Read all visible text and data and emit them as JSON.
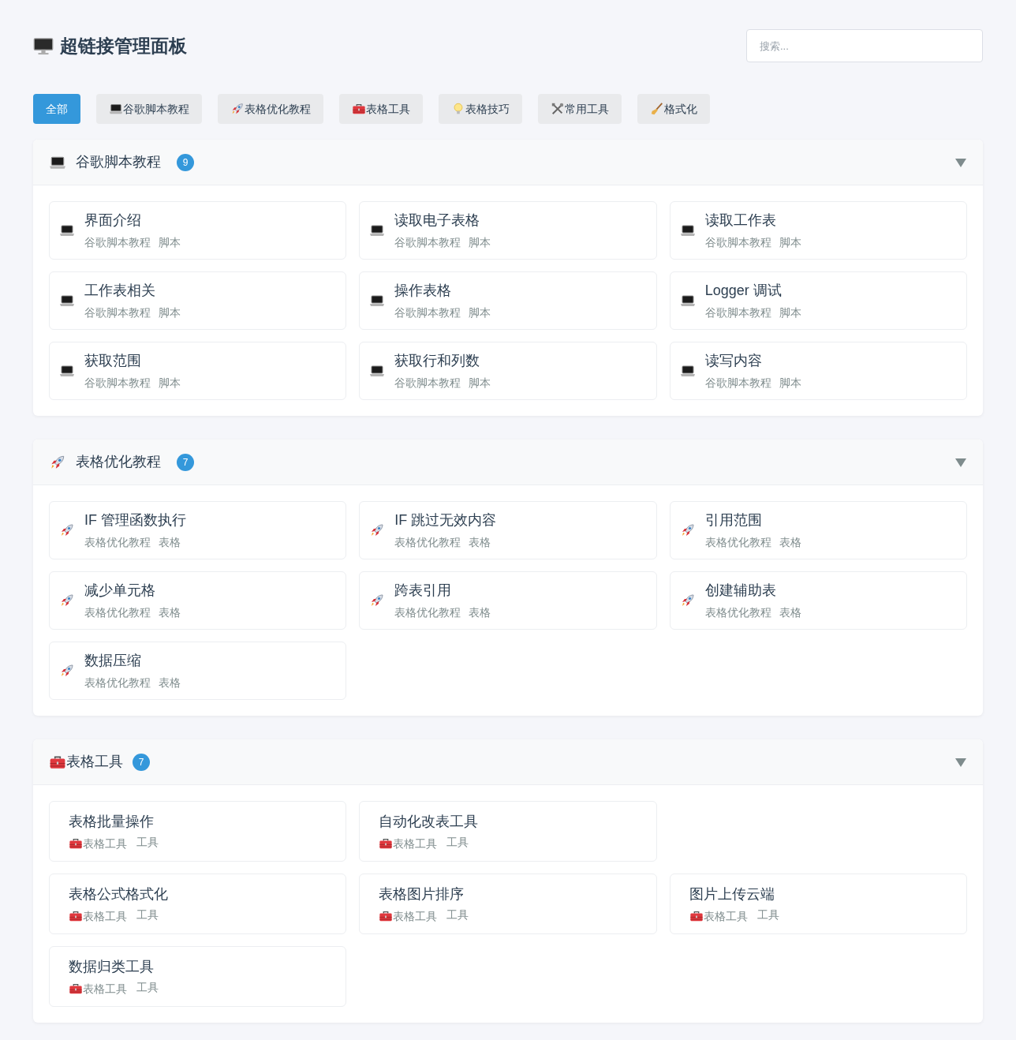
{
  "header": {
    "kind": "desktop",
    "title": "超链接管理面板"
  },
  "search": {
    "placeholder": "搜索..."
  },
  "tabs": [
    {
      "label": "全部",
      "selected": true
    },
    {
      "kind": "laptop",
      "label": "谷歌脚本教程",
      "selected": false
    },
    {
      "kind": "rocket",
      "label": "表格优化教程",
      "selected": false
    },
    {
      "kind": "toolbox",
      "label": "表格工具",
      "selected": false
    },
    {
      "kind": "bulb",
      "label": "表格技巧",
      "selected": false
    },
    {
      "kind": "tools",
      "label": "常用工具",
      "selected": false
    },
    {
      "kind": "broom",
      "label": "格式化",
      "selected": false
    }
  ],
  "sections": [
    {
      "kind": "laptop",
      "title": "谷歌脚本教程",
      "count": "9",
      "expanded": true,
      "rows": [
        [
          {
            "title": "界面介绍",
            "category": "谷歌脚本教程",
            "tag": "脚本"
          },
          {
            "title": "读取电子表格",
            "category": "谷歌脚本教程",
            "tag": "脚本"
          },
          {
            "title": "读取工作表",
            "category": "谷歌脚本教程",
            "tag": "脚本"
          }
        ],
        [
          {
            "title": "工作表相关",
            "category": "谷歌脚本教程",
            "tag": "脚本"
          },
          {
            "title": "操作表格",
            "category": "谷歌脚本教程",
            "tag": "脚本"
          },
          {
            "title": "Logger 调试",
            "category": "谷歌脚本教程",
            "tag": "脚本"
          }
        ],
        [
          {
            "title": "获取范围",
            "category": "谷歌脚本教程",
            "tag": "脚本"
          },
          {
            "title": "获取行和列数",
            "category": "谷歌脚本教程",
            "tag": "脚本"
          },
          {
            "title": "读写内容",
            "category": "谷歌脚本教程",
            "tag": "脚本"
          }
        ]
      ]
    },
    {
      "kind": "rocket",
      "title": "表格优化教程",
      "count": "7",
      "expanded": true,
      "rows": [
        [
          {
            "title": "IF 管理函数执行",
            "category": "表格优化教程",
            "tag": "表格"
          },
          {
            "title": "IF 跳过无效内容",
            "category": "表格优化教程",
            "tag": "表格"
          },
          {
            "title": "引用范围",
            "category": "表格优化教程",
            "tag": "表格"
          }
        ],
        [
          {
            "title": "减少单元格",
            "category": "表格优化教程",
            "tag": "表格"
          },
          {
            "title": "跨表引用",
            "category": "表格优化教程",
            "tag": "表格"
          },
          {
            "title": "创建辅助表",
            "category": "表格优化教程",
            "tag": "表格"
          }
        ],
        [
          {
            "title": "数据压缩",
            "category": "表格优化教程",
            "tag": "表格"
          }
        ]
      ]
    },
    {
      "kind": "toolbox",
      "title": "表格工具",
      "count": "7",
      "expanded": true,
      "rows": [
        [
          {
            "title": "表格批量操作",
            "category": "表格工具",
            "tag": "工具"
          },
          {
            "title": "自动化改表工具",
            "category": "表格工具",
            "tag": "工具"
          }
        ],
        [
          {
            "title": "表格公式格式化",
            "category": "表格工具",
            "tag": "工具"
          },
          {
            "title": "表格图片排序",
            "category": "表格工具",
            "tag": "工具"
          },
          {
            "title": "图片上传云端",
            "category": "表格工具",
            "tag": "工具"
          }
        ],
        [
          {
            "title": "数据归类工具",
            "category": "表格工具",
            "tag": "工具"
          }
        ]
      ]
    }
  ]
}
